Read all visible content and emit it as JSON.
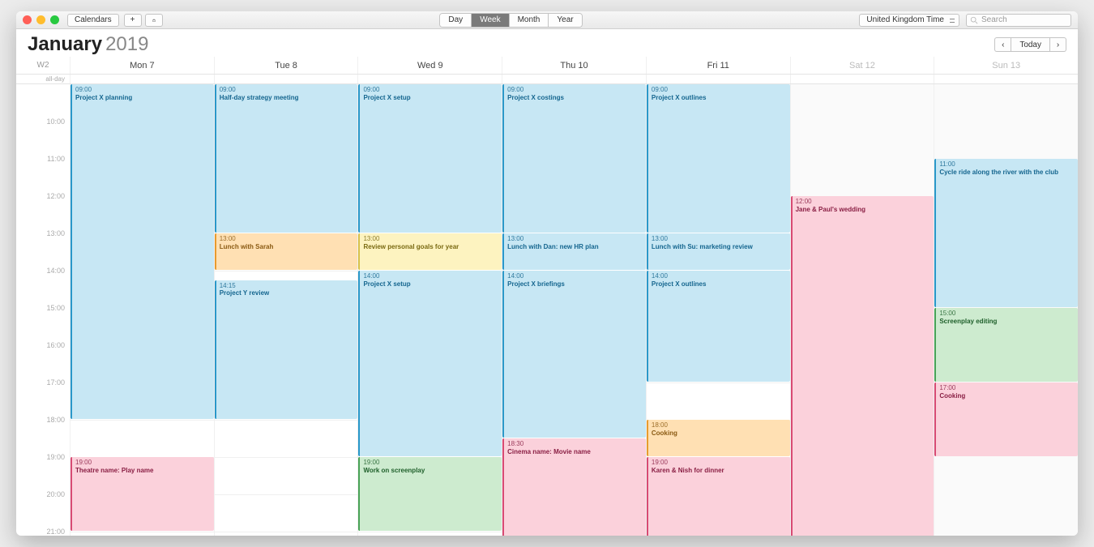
{
  "toolbar": {
    "calendars": "Calendars",
    "view": {
      "day": "Day",
      "week": "Week",
      "month": "Month",
      "year": "Year"
    },
    "timezone": "United Kingdom Time",
    "searchPlaceholder": "Search"
  },
  "header": {
    "month": "January",
    "year": "2019",
    "today": "Today"
  },
  "weekLabel": "W2",
  "alldayLabel": "all-day",
  "days": [
    {
      "label": "Mon 7",
      "weekend": false
    },
    {
      "label": "Tue 8",
      "weekend": false
    },
    {
      "label": "Wed 9",
      "weekend": false
    },
    {
      "label": "Thu 10",
      "weekend": false
    },
    {
      "label": "Fri 11",
      "weekend": false
    },
    {
      "label": "Sat 12",
      "weekend": true
    },
    {
      "label": "Sun 13",
      "weekend": true
    }
  ],
  "timeStart": 9,
  "timeEnd": 21,
  "hourPx": 46,
  "events": [
    {
      "day": 0,
      "start": 9,
      "end": 18,
      "time": "09:00",
      "title": "Project X planning",
      "color": "blue"
    },
    {
      "day": 0,
      "start": 19,
      "end": 21,
      "time": "19:00",
      "title": "Theatre name: Play name",
      "color": "pink"
    },
    {
      "day": 1,
      "start": 9,
      "end": 13,
      "time": "09:00",
      "title": "Half-day strategy meeting",
      "color": "blue"
    },
    {
      "day": 1,
      "start": 13,
      "end": 14,
      "time": "13:00",
      "title": "Lunch with Sarah",
      "color": "orange"
    },
    {
      "day": 1,
      "start": 14.25,
      "end": 18,
      "time": "14:15",
      "title": "Project Y review",
      "color": "blue"
    },
    {
      "day": 2,
      "start": 9,
      "end": 13,
      "time": "09:00",
      "title": "Project X setup",
      "color": "blue"
    },
    {
      "day": 2,
      "start": 13,
      "end": 14,
      "time": "13:00",
      "title": "Review personal goals for year",
      "color": "yellow"
    },
    {
      "day": 2,
      "start": 14,
      "end": 19,
      "time": "14:00",
      "title": "Project X setup",
      "color": "blue"
    },
    {
      "day": 2,
      "start": 19,
      "end": 21,
      "time": "19:00",
      "title": "Work on screenplay",
      "color": "green"
    },
    {
      "day": 3,
      "start": 9,
      "end": 13,
      "time": "09:00",
      "title": "Project X costings",
      "color": "blue"
    },
    {
      "day": 3,
      "start": 13,
      "end": 14,
      "time": "13:00",
      "title": "Lunch with Dan: new HR plan",
      "color": "blue"
    },
    {
      "day": 3,
      "start": 14,
      "end": 18.5,
      "time": "14:00",
      "title": "Project X briefings",
      "color": "blue"
    },
    {
      "day": 3,
      "start": 18.5,
      "end": 21.5,
      "time": "18:30",
      "title": "Cinema name: Movie name",
      "color": "pink"
    },
    {
      "day": 4,
      "start": 9,
      "end": 13,
      "time": "09:00",
      "title": "Project X outlines",
      "color": "blue"
    },
    {
      "day": 4,
      "start": 13,
      "end": 14,
      "time": "13:00",
      "title": "Lunch with Su: marketing review",
      "color": "blue"
    },
    {
      "day": 4,
      "start": 14,
      "end": 17,
      "time": "14:00",
      "title": "Project X outlines",
      "color": "blue"
    },
    {
      "day": 4,
      "start": 18,
      "end": 19,
      "time": "18:00",
      "title": "Cooking",
      "color": "orange"
    },
    {
      "day": 4,
      "start": 19,
      "end": 21.5,
      "time": "19:00",
      "title": "Karen & Nish for dinner",
      "color": "pink"
    },
    {
      "day": 5,
      "start": 12,
      "end": 21.5,
      "time": "12:00",
      "title": "Jane & Paul's wedding",
      "color": "pink"
    },
    {
      "day": 6,
      "start": 11,
      "end": 15,
      "time": "11:00",
      "title": "Cycle ride along the river with the club",
      "color": "blue"
    },
    {
      "day": 6,
      "start": 15,
      "end": 17,
      "time": "15:00",
      "title": "Screenplay editing",
      "color": "green"
    },
    {
      "day": 6,
      "start": 17,
      "end": 19,
      "time": "17:00",
      "title": "Cooking",
      "color": "pink"
    }
  ]
}
